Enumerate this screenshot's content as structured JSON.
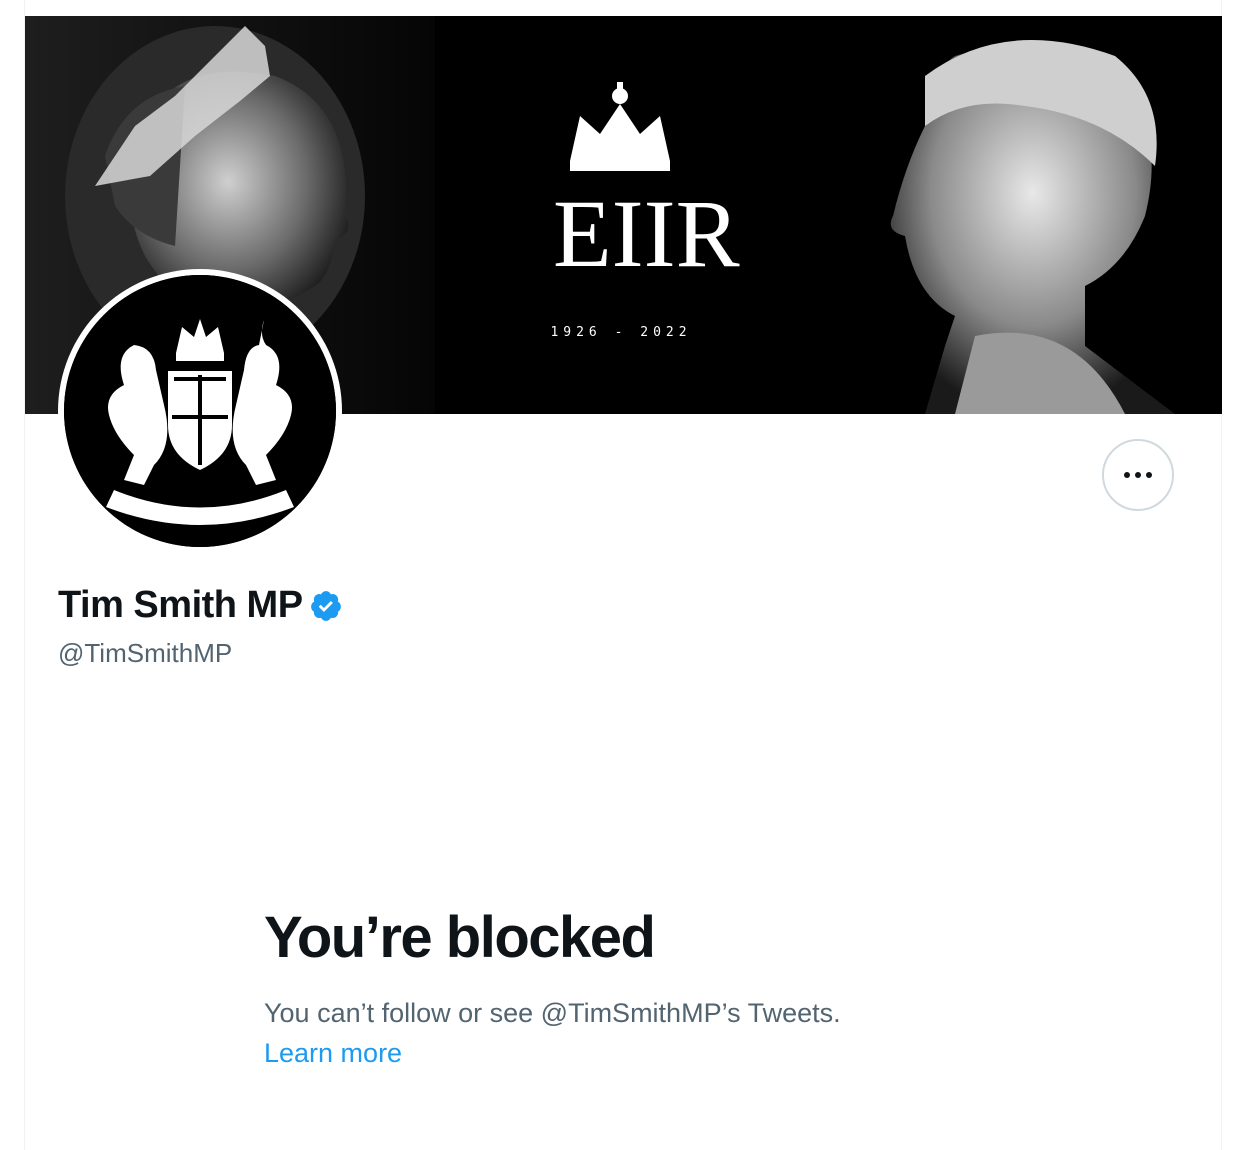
{
  "banner": {
    "cipher_letters": "EIIR",
    "dates": "1926 - 2022"
  },
  "profile": {
    "display_name": "Tim Smith MP",
    "handle": "@TimSmithMP",
    "verified": true
  },
  "more_button": {
    "icon": "more-horizontal-icon"
  },
  "blocked": {
    "title": "You’re blocked",
    "message": "You can’t follow or see @TimSmithMP’s Tweets.",
    "learn_more": "Learn more"
  },
  "colors": {
    "text_primary": "#0f1419",
    "text_secondary": "#536471",
    "link": "#1d9bf0",
    "verified_badge": "#1d9bf0"
  }
}
